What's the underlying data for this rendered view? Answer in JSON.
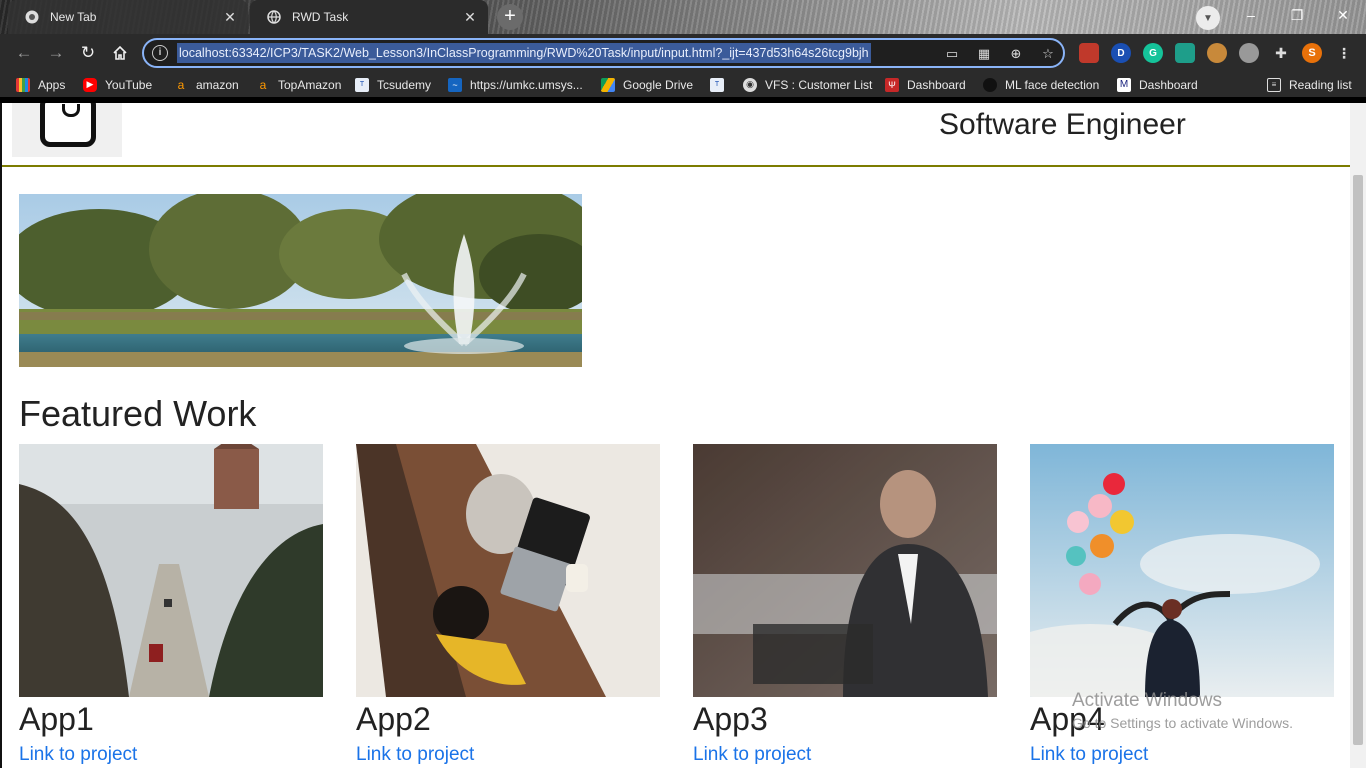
{
  "browser": {
    "tabs": [
      {
        "title": "New Tab",
        "active": false
      },
      {
        "title": "RWD Task",
        "active": true
      }
    ],
    "new_tab_glyph": "+",
    "close_glyph": "✕",
    "window_controls": [
      "–",
      "❐",
      "✕"
    ],
    "url": "localhost:63342/ICP3/TASK2/Web_Lesson3/InClassProgramming/RWD%20Task/input/input.html?_ijt=437d53h64s26tcg9bjh",
    "profile_initial": "S",
    "bookmarks": [
      {
        "label": "Apps",
        "icon": "apps-grid-icon"
      },
      {
        "label": "YouTube",
        "icon": "youtube-icon"
      },
      {
        "label": "amazon",
        "icon": "amazon-icon"
      },
      {
        "label": "TopAmazon",
        "icon": "amazon-icon"
      },
      {
        "label": "Tcsudemy",
        "icon": "tata-icon"
      },
      {
        "label": "https://umkc.umsys...",
        "icon": "umkc-icon"
      },
      {
        "label": "Google Drive",
        "icon": "google-drive-icon"
      },
      {
        "label": "",
        "icon": "tata-icon"
      },
      {
        "label": "VFS : Customer List",
        "icon": "globe-icon"
      },
      {
        "label": "Dashboard",
        "icon": "dashboard-red-icon"
      },
      {
        "label": "ML face detection",
        "icon": "github-icon"
      },
      {
        "label": "Dashboard",
        "icon": "dashboard-icon"
      }
    ],
    "reading_list": "Reading list"
  },
  "page": {
    "job_title": "Software Engineer",
    "section_title": "Featured Work",
    "projects": [
      {
        "name": "App1",
        "link": "Link to project"
      },
      {
        "name": "App2",
        "link": "Link to project"
      },
      {
        "name": "App3",
        "link": "Link to project"
      },
      {
        "name": "App4",
        "link": "Link to project"
      }
    ]
  },
  "os_watermark": {
    "line1": "Activate Windows",
    "line2": "Go to Settings to activate Windows."
  },
  "colors": {
    "link": "#1a73e8",
    "header_rule": "#7c7c00",
    "omnibox_focus": "#8ab4f8"
  }
}
